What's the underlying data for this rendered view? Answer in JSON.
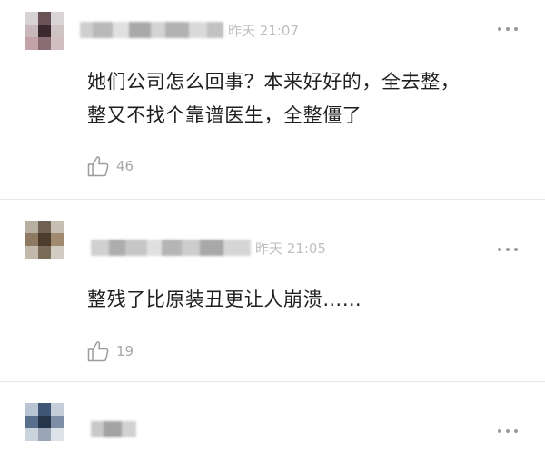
{
  "icons": {
    "like": "thumbs-up-outline-icon",
    "more": "more-dots-icon"
  },
  "colors": {
    "text": "#1f1f1f",
    "meta": "#bfbfbf",
    "count": "#a8a8a8",
    "divider": "#e8e8e8"
  },
  "comments": [
    {
      "time": "昨天 21:07",
      "content_lines": [
        "她们公司怎么回事？本来好好的，全去整，",
        "整又不找个靠谱医生，全整僵了"
      ],
      "likes": "46"
    },
    {
      "time": "昨天 21:05",
      "content_lines": [
        "整残了比原装丑更让人崩溃……"
      ],
      "likes": "19"
    },
    {
      "time": "",
      "content_lines": [],
      "likes": ""
    }
  ]
}
